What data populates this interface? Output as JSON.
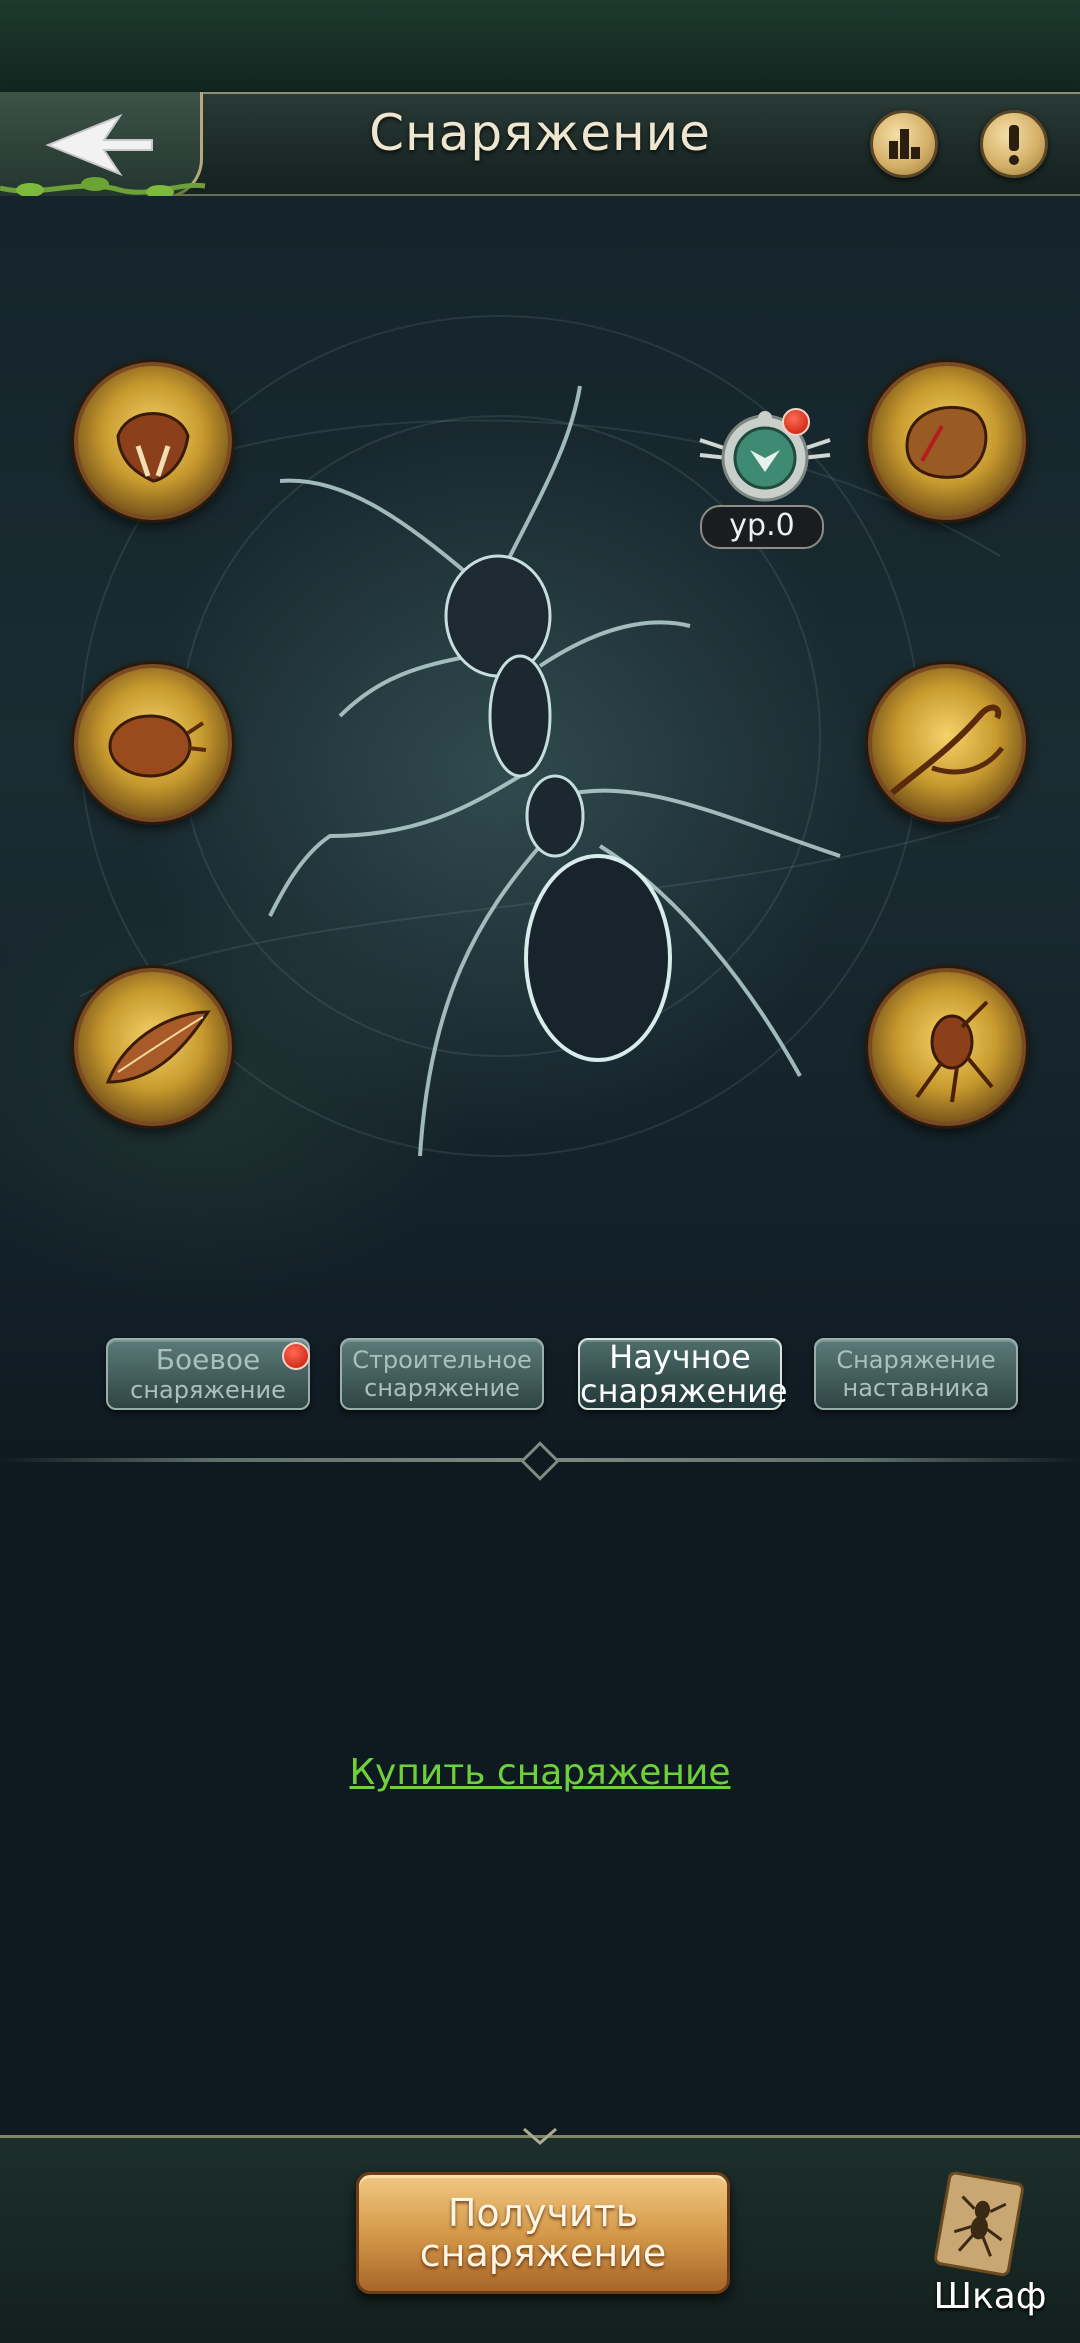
{
  "header": {
    "title": "Снаряжение"
  },
  "equipment": {
    "level_badge": "ур.0"
  },
  "tabs": [
    {
      "line1": "Боевое",
      "line2": "снаряжение"
    },
    {
      "line1": "Строительное",
      "line2": "снаряжение"
    },
    {
      "line1": "Научное",
      "line2": "снаряжение"
    },
    {
      "line1": "Снаряжение",
      "line2": "наставника"
    }
  ],
  "active_tab": "Научное снаряжение",
  "main": {
    "buy_link": "Купить снаряжение"
  },
  "bottom": {
    "get_button_line1": "Получить",
    "get_button_line2": "снаряжение",
    "closet_label": "Шкаф"
  },
  "colors": {
    "link_green": "#6fd13a",
    "notification_red": "#d2301c",
    "gold_button": "#d59a4a"
  }
}
